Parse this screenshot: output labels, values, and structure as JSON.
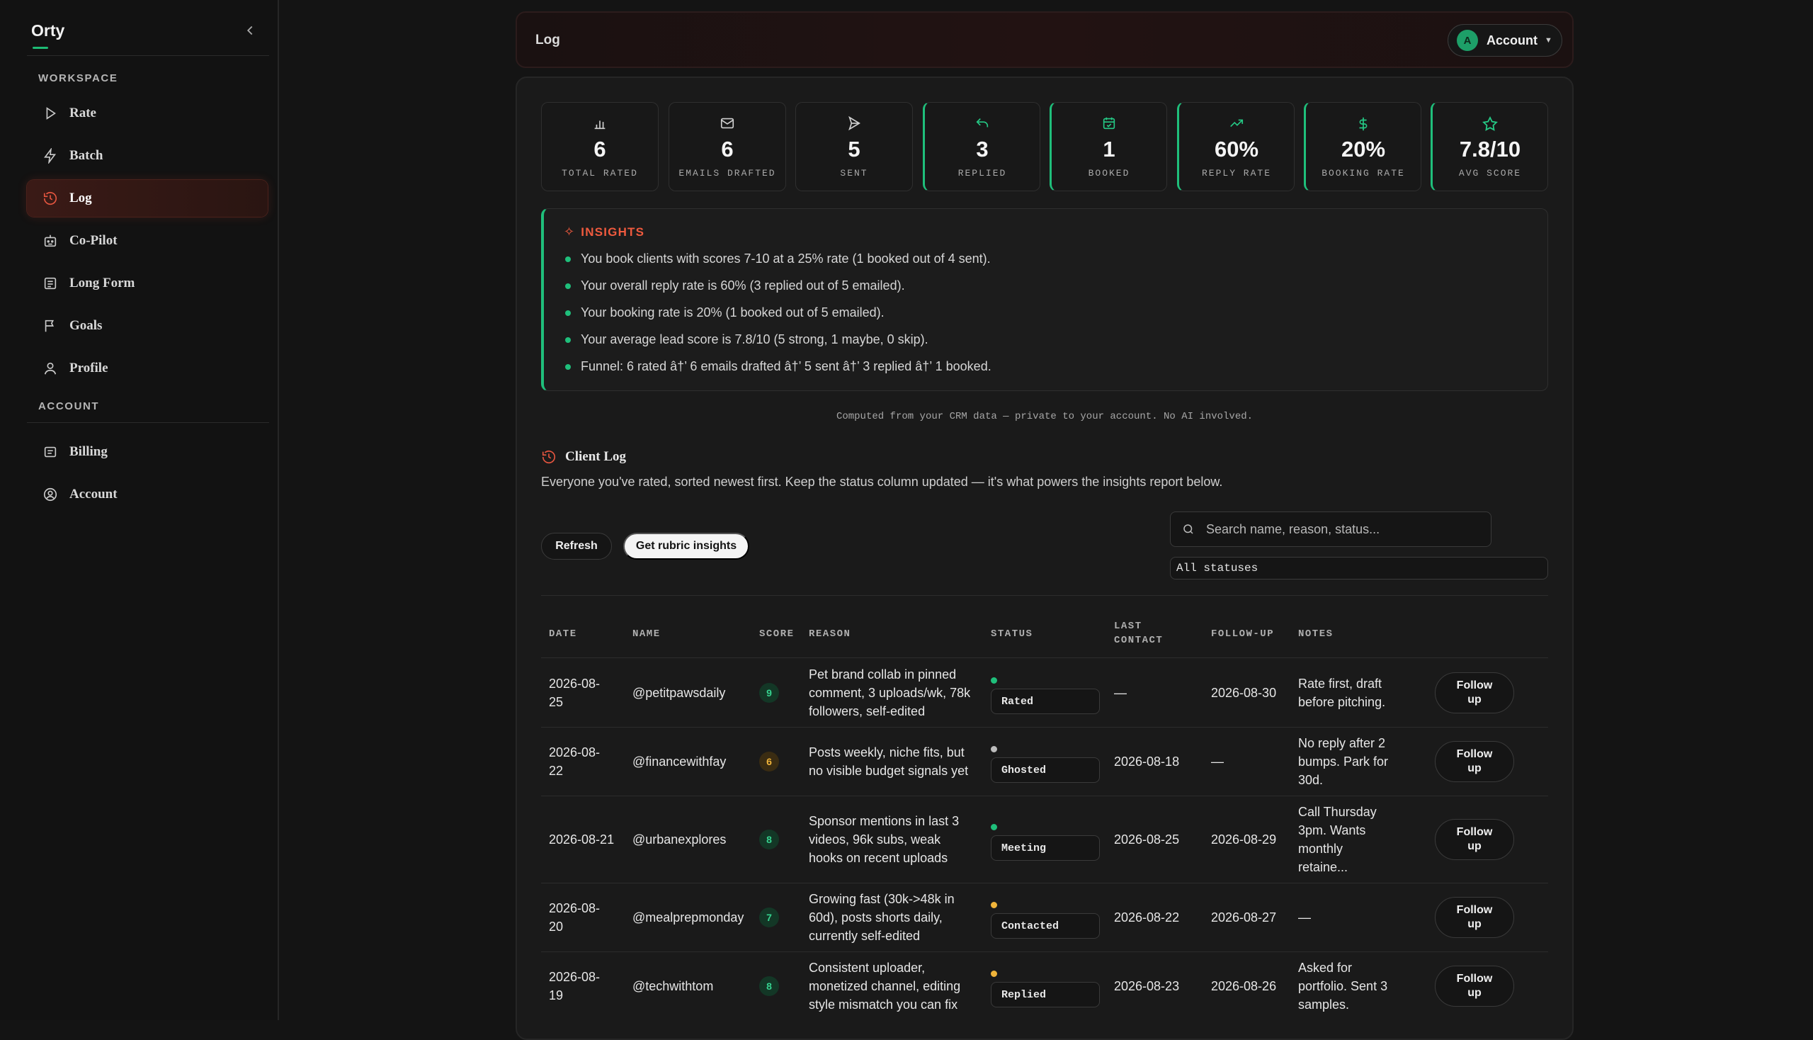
{
  "sidebar": {
    "brand": "Orty",
    "workspace_label": "WORKSPACE",
    "account_label": "ACCOUNT",
    "workspace_items": [
      {
        "label": "Rate",
        "icon": "play-icon"
      },
      {
        "label": "Batch",
        "icon": "bolt-icon"
      },
      {
        "label": "Log",
        "icon": "history-icon",
        "active": true
      },
      {
        "label": "Co-Pilot",
        "icon": "robot-icon"
      },
      {
        "label": "Long Form",
        "icon": "document-icon"
      },
      {
        "label": "Goals",
        "icon": "flag-icon"
      },
      {
        "label": "Profile",
        "icon": "user-icon"
      }
    ],
    "account_items": [
      {
        "label": "Billing",
        "icon": "receipt-icon"
      },
      {
        "label": "Account",
        "icon": "user-circle-icon"
      }
    ]
  },
  "header": {
    "title": "Log",
    "account_initial": "A",
    "account_label": "Account"
  },
  "stats": [
    {
      "value": "6",
      "label": "TOTAL RATED",
      "icon": "bar-chart-icon"
    },
    {
      "value": "6",
      "label": "EMAILS DRAFTED",
      "icon": "mail-icon"
    },
    {
      "value": "5",
      "label": "SENT",
      "icon": "send-icon"
    },
    {
      "value": "3",
      "label": "REPLIED",
      "icon": "reply-icon"
    },
    {
      "value": "1",
      "label": "BOOKED",
      "icon": "calendar-check-icon"
    },
    {
      "value": "60%",
      "label": "REPLY RATE",
      "icon": "trending-up-icon"
    },
    {
      "value": "20%",
      "label": "BOOKING RATE",
      "icon": "dollar-icon"
    },
    {
      "value": "7.8/10",
      "label": "AVG SCORE",
      "icon": "star-icon"
    }
  ],
  "insights": {
    "title": "INSIGHTS",
    "lines": [
      "You book clients with scores 7-10 at a 25% rate (1 booked out of 4 sent).",
      "Your overall reply rate is 60% (3 replied out of 5 emailed).",
      "Your booking rate is 20% (1 booked out of 5 emailed).",
      "Your average lead score is 7.8/10 (5 strong, 1 maybe, 0 skip).",
      "Funnel: 6 rated â†’ 6 emails drafted â†’ 5 sent â†’ 3 replied â†’ 1 booked."
    ]
  },
  "computed_note": "Computed from your CRM data — private to your account. No AI involved.",
  "client_log": {
    "title": "Client Log",
    "description": "Everyone you've rated, sorted newest first. Keep the status column updated — it's what powers the insights report below.",
    "refresh_label": "Refresh",
    "rubric_label": "Get rubric insights",
    "search_placeholder": "Search name, reason, status...",
    "status_filter": "All statuses"
  },
  "table": {
    "headers": {
      "date": "DATE",
      "name": "NAME",
      "score": "SCORE",
      "reason": "REASON",
      "status": "STATUS",
      "last_contact_1": "LAST",
      "last_contact_2": "CONTACT",
      "follow_up": "FOLLOW-UP",
      "notes": "NOTES"
    },
    "follow_up_label_1": "Follow",
    "follow_up_label_2": "up",
    "rows": [
      {
        "date_1": "2026-08-",
        "date_2": "25",
        "name": "@petitpawsdaily",
        "score": "9",
        "score_level": "hi",
        "reason": [
          "Pet brand collab in pinned",
          "comment, 3 uploads/wk, 78k",
          "followers, self-edited"
        ],
        "status": "Rated",
        "status_color": "#1fbf7b",
        "last_contact": "—",
        "follow_up": "2026-08-30",
        "notes": [
          "Rate first, draft",
          "before pitching."
        ]
      },
      {
        "date_1": "2026-08-",
        "date_2": "22",
        "name": "@financewithfay",
        "score": "6",
        "score_level": "mid",
        "reason": [
          "Posts weekly, niche fits, but",
          "no visible budget signals yet"
        ],
        "status": "Ghosted",
        "status_color": "#bdbdbd",
        "last_contact": "2026-08-18",
        "follow_up": "—",
        "notes": [
          "No reply after 2",
          "bumps. Park for",
          "30d."
        ]
      },
      {
        "date_1": "2026-08-21",
        "date_2": "",
        "name": "@urbanexplores",
        "score": "8",
        "score_level": "hi",
        "reason": [
          "Sponsor mentions in last 3",
          "videos, 96k subs, weak",
          "hooks on recent uploads"
        ],
        "status": "Meeting",
        "status_color": "#1fbf7b",
        "last_contact": "2026-08-25",
        "follow_up": "2026-08-29",
        "notes": [
          "Call Thursday",
          "3pm. Wants",
          "monthly",
          "retaine..."
        ]
      },
      {
        "date_1": "2026-08-",
        "date_2": "20",
        "name": "@mealprepmonday",
        "score": "7",
        "score_level": "hi",
        "reason": [
          "Growing fast (30k->48k in",
          "60d), posts shorts daily,",
          "currently self-edited"
        ],
        "status": "Contacted",
        "status_color": "#f0b43a",
        "last_contact": "2026-08-22",
        "follow_up": "2026-08-27",
        "notes": [
          "—"
        ]
      },
      {
        "date_1": "2026-08-",
        "date_2": "19",
        "name": "@techwithtom",
        "score": "8",
        "score_level": "hi",
        "reason": [
          "Consistent uploader,",
          "monetized channel, editing",
          "style mismatch you can fix"
        ],
        "status": "Replied",
        "status_color": "#f0b43a",
        "last_contact": "2026-08-23",
        "follow_up": "2026-08-26",
        "notes": [
          "Asked for",
          "portfolio. Sent 3",
          "samples."
        ]
      }
    ]
  }
}
